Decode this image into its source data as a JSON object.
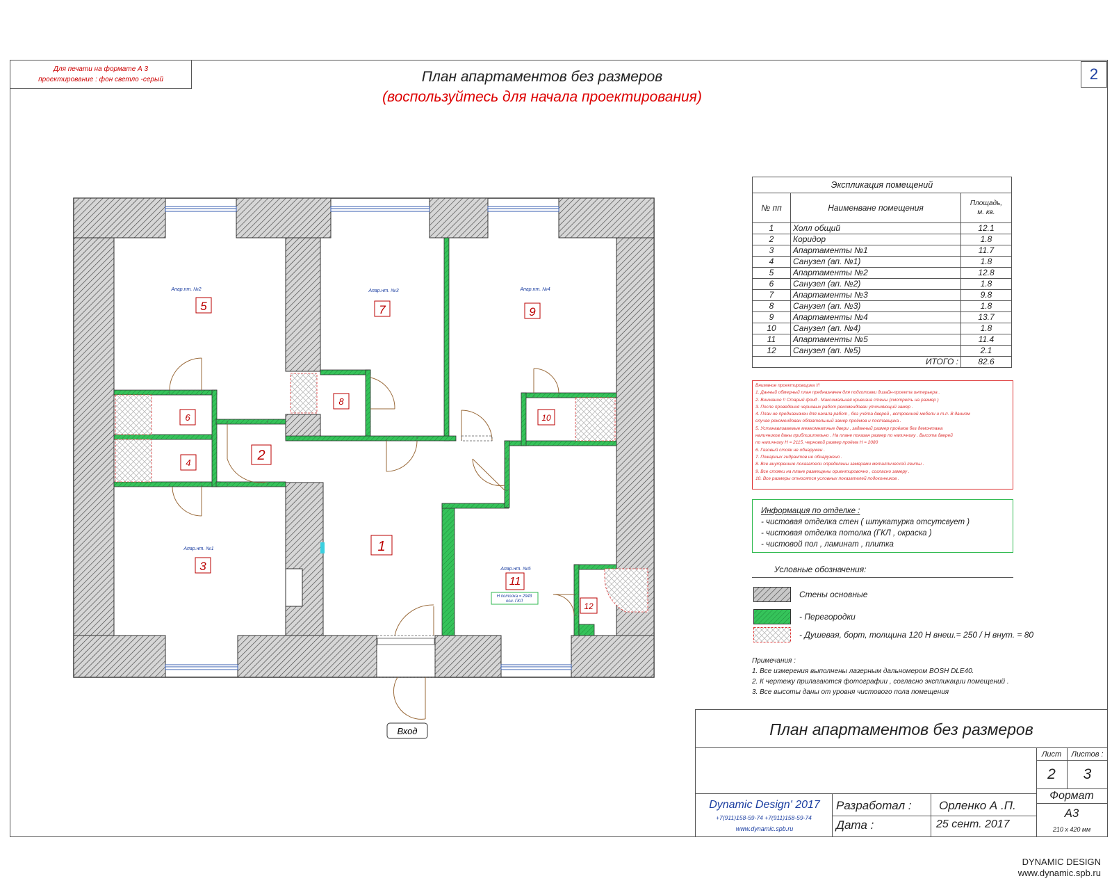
{
  "header": {
    "print_note_line1": "Для печати на формате А 3",
    "print_note_line2": "проектирование : фон светло -серый",
    "sheet_number": "2",
    "title": "План апартаментов без размеров",
    "subtitle": "(воспользуйтесь для начала проектирования)"
  },
  "plan": {
    "rooms": [
      {
        "num": "5",
        "label": "Апар.нт. №2"
      },
      {
        "num": "7",
        "label": "Апар.нт. №3"
      },
      {
        "num": "9",
        "label": "Апар.нт. №4"
      },
      {
        "num": "8",
        "label": ""
      },
      {
        "num": "6",
        "label": ""
      },
      {
        "num": "4",
        "label": ""
      },
      {
        "num": "2",
        "label": ""
      },
      {
        "num": "10",
        "label": ""
      },
      {
        "num": "3",
        "label": "Апар.нт. №1"
      },
      {
        "num": "1",
        "label": ""
      },
      {
        "num": "11",
        "label": "Апар.нт. №5"
      },
      {
        "num": "12",
        "label": ""
      }
    ],
    "height_note_line1": "Н потолка = 2943",
    "height_note_line2": "осн. ГКЛ",
    "entrance_label": "Вход"
  },
  "explication": {
    "title": "Экспликация помещений",
    "col_num": "№ пп",
    "col_name": "Наименване помещения",
    "col_area_line1": "Площадь,",
    "col_area_line2": "м. кв.",
    "rows": [
      {
        "n": "1",
        "name": "Холл общий",
        "area": "12.1"
      },
      {
        "n": "2",
        "name": "Коридор",
        "area": "1.8"
      },
      {
        "n": "3",
        "name": "Апартаменты №1",
        "area": "11.7"
      },
      {
        "n": "4",
        "name": "Санузел (ап. №1)",
        "area": "1.8"
      },
      {
        "n": "5",
        "name": "Апартаменты №2",
        "area": "12.8"
      },
      {
        "n": "6",
        "name": "Санузел (ап. №2)",
        "area": "1.8"
      },
      {
        "n": "7",
        "name": "Апартаменты №3",
        "area": "9.8"
      },
      {
        "n": "8",
        "name": "Санузел (ап. №3)",
        "area": "1.8"
      },
      {
        "n": "9",
        "name": "Апартаменты №4",
        "area": "13.7"
      },
      {
        "n": "10",
        "name": "Санузел (ап. №4)",
        "area": "1.8"
      },
      {
        "n": "11",
        "name": "Апартаменты №5",
        "area": "11.4"
      },
      {
        "n": "12",
        "name": "Санузел (ап. №5)",
        "area": "2.1"
      }
    ],
    "total_label": "ИТОГО :",
    "total_value": "82.6"
  },
  "notes": [
    "Внимание проектировщика !!!",
    "1. Данный обмерный план предназначен для подготовки дизайн-проекта интерьера .",
    "2. Внимание !! Старый фонд . Максимальная кривизна стены (смотреть на размер )",
    "3. После проведения черновых работ рекомендован уточняющий замер .",
    "4. План не предназначен для начала работ , без учёта дверей , встроенной мебели и т.п. В данном",
    "случае рекомендован обязательный замер проёмов и поставщика .",
    "5. Устанавливаемые межкомнатные двери , заданный размер проёмов без демонтажа",
    "наличников даны приблизительно . На плане показан размер по наличнику . Высота дверей",
    "по наличнику Н = 2115, черновой размер проёма Н = 2080",
    "6. Газовый стояк не обнаружен .",
    "7. Пожарных гидрантов не обнаружено .",
    "8. Все внутренние показатели определены замерами металлической ленты .",
    "9. Все стояки на плане размещены ориентировочно , согласно замеру .",
    "10. Все размеры относятся условных показателей подоконников ."
  ],
  "finish_info": {
    "title": "Информация по отделке :",
    "items": [
      "- чистовая  отделка стен   ( штукатурка отсутсвует  )",
      "- чистовая отделка потолка    (ГКЛ , окраска )",
      "- чистовой пол , ламинат , плитка"
    ]
  },
  "legend": {
    "title": "Условные обозначения:",
    "items": [
      {
        "text": "Стены основные",
        "kind": "wall"
      },
      {
        "text": "- Перегородки",
        "kind": "partition"
      },
      {
        "text": "- Душевая, борт, толщина 120   Н внеш.= 250  / Н внут. = 80",
        "kind": "shower"
      }
    ]
  },
  "remarks": [
    "Примечания :",
    "1. Все измерения выполнены лазерным дальномером   BOSH DLE40.",
    "2. К чертежу прилагаются фотографии , согласно экспликации помещений .",
    "3. Все высоты даны от уровня чистового пола помещения"
  ],
  "stamp": {
    "title": "План апартаментов без размеров",
    "sheet_label": "Лист",
    "sheets_label": "Листов :",
    "sheet": "2",
    "sheets": "3",
    "format_label": "Формат",
    "format": "А3",
    "format_size": "210 х 420 мм",
    "company": "Dynamic Design' 2017",
    "phones": "+7(911)158-59-74      +7(911)158-59-74",
    "site": "www.dynamic.spb.ru",
    "dev_label": "Разработал :",
    "dev_name": "Орленко А .П.",
    "date_label": "Дата :",
    "date": "25 сент. 2017"
  },
  "footer": {
    "brand": "DYNAMIC DESIGN",
    "url": "www.dynamic.spb.ru"
  },
  "colors": {
    "partition": "#35c35a",
    "shower": "#d33",
    "accent_red": "#d00",
    "accent_blue": "#1a3da0"
  }
}
